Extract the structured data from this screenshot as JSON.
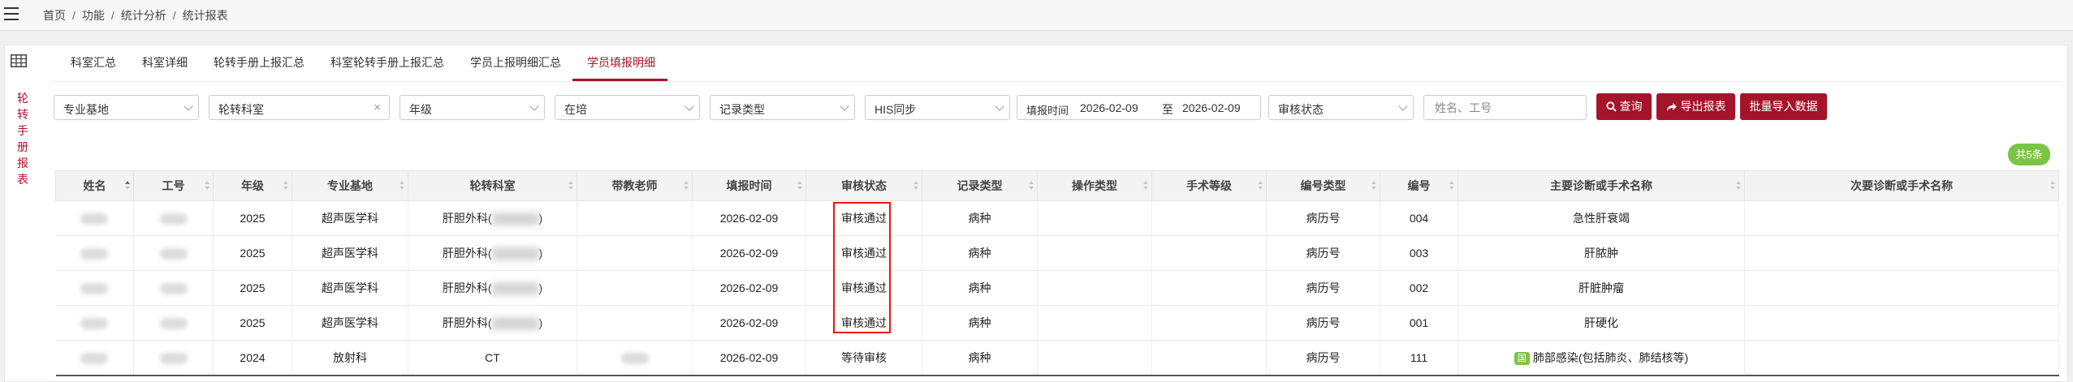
{
  "breadcrumb": [
    "首页",
    "功能",
    "统计分析",
    "统计报表"
  ],
  "sidebar_title": [
    "轮",
    "转",
    "手",
    "册",
    "报",
    "表"
  ],
  "tabs": [
    "科室汇总",
    "科室详细",
    "轮转手册上报汇总",
    "科室轮转手册上报汇总",
    "学员上报明细汇总",
    "学员填报明细"
  ],
  "filters": {
    "base": "专业基地",
    "dept": "轮转科室",
    "clear": "×",
    "grade": "年级",
    "status": "在培",
    "record_type": "记录类型",
    "his_sync": "HIS同步",
    "date_label": "填报时间",
    "date_from": "2026-02-09",
    "date_to_label": "至",
    "date_to": "2026-02-09",
    "review_status": "审核状态",
    "name_placeholder": "姓名、工号"
  },
  "buttons": {
    "query": "查询",
    "export": "导出报表",
    "import": "批量导入数据"
  },
  "total_badge": "共5条",
  "table": {
    "headers": [
      "姓名",
      "工号",
      "年级",
      "专业基地",
      "轮转科室",
      "带教老师",
      "填报时间",
      "审核状态",
      "记录类型",
      "操作类型",
      "手术等级",
      "编号类型",
      "编号",
      "主要诊断或手术名称",
      "次要诊断或手术名称"
    ],
    "rows": [
      {
        "grade": "2025",
        "base": "超声医学科",
        "dept": "肝胆外科(",
        "date": "2026-02-09",
        "status": "审核通过",
        "record_type": "病种",
        "id_type": "病历号",
        "id": "004",
        "diag": "急性肝衰竭",
        "diag_tag": "",
        "diag2": ""
      },
      {
        "grade": "2025",
        "base": "超声医学科",
        "dept": "肝胆外科(",
        "date": "2026-02-09",
        "status": "审核通过",
        "record_type": "病种",
        "id_type": "病历号",
        "id": "003",
        "diag": "肝脓肿",
        "diag_tag": "",
        "diag2": ""
      },
      {
        "grade": "2025",
        "base": "超声医学科",
        "dept": "肝胆外科(",
        "date": "2026-02-09",
        "status": "审核通过",
        "record_type": "病种",
        "id_type": "病历号",
        "id": "002",
        "diag": "肝脏肿瘤",
        "diag_tag": "",
        "diag2": ""
      },
      {
        "grade": "2025",
        "base": "超声医学科",
        "dept": "肝胆外科(",
        "date": "2026-02-09",
        "status": "审核通过",
        "record_type": "病种",
        "id_type": "病历号",
        "id": "001",
        "diag": "肝硬化",
        "diag_tag": "",
        "diag2": ""
      },
      {
        "grade": "2024",
        "base": "放射科",
        "dept": "CT",
        "date": "2026-02-09",
        "status": "等待审核",
        "record_type": "病种",
        "id_type": "病历号",
        "id": "111",
        "diag": "肺部感染(包括肺炎、肺结核等)",
        "diag_tag": "国",
        "diag2": ""
      }
    ]
  },
  "colors": {
    "accent": "#a5142b",
    "badge_green": "#7cc447",
    "highlight_red": "#ee1111"
  }
}
